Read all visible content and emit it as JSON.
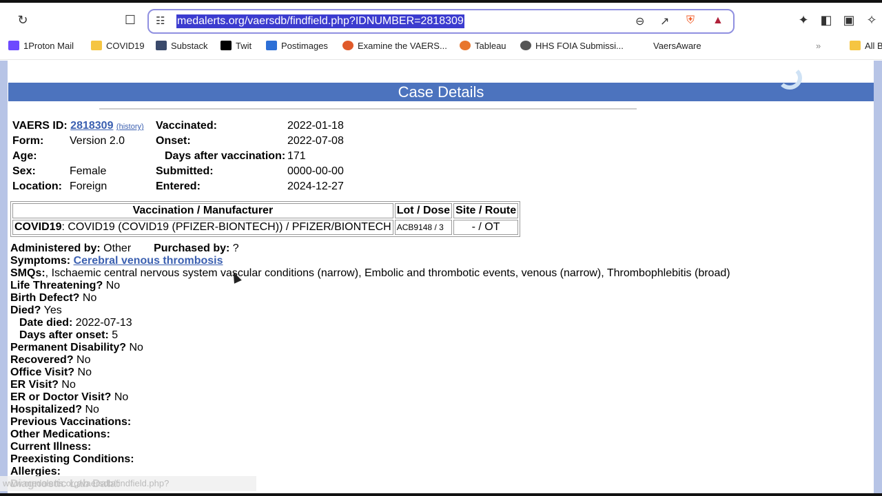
{
  "browser": {
    "url": "medalerts.org/vaersdb/findfield.php?IDNUMBER=2818309",
    "toolbar_icons": [
      "reload-icon",
      "bookmark-icon",
      "site-settings-icon",
      "zoom-out-icon",
      "share-icon",
      "brave-shields-icon",
      "brave-rewards-icon",
      "extensions-icon",
      "sidebar-icon",
      "wallet-icon",
      "leo-ai-icon"
    ],
    "bookmarks": [
      {
        "label": "1Proton Mail",
        "icon": "proton-mail-icon",
        "color": "#6d4aff"
      },
      {
        "label": "COVID19",
        "icon": "folder-icon",
        "color": "#f5c542"
      },
      {
        "label": "Substack",
        "icon": "substack-icon",
        "color": "#3a4a6b"
      },
      {
        "label": "Twit",
        "icon": "x-icon",
        "color": "#000000"
      },
      {
        "label": "Postimages",
        "icon": "postimages-icon",
        "color": "#2d6fd6"
      },
      {
        "label": "Examine the VAERS...",
        "icon": "vaers-icon",
        "color": "#e05a2a"
      },
      {
        "label": "Tableau",
        "icon": "tableau-icon",
        "color": "#e8762d"
      },
      {
        "label": "HHS FOIA Submissi...",
        "icon": "globe-icon",
        "color": "#555555"
      },
      {
        "label": "VaersAware",
        "icon": "",
        "color": ""
      },
      {
        "label": "»",
        "icon": "overflow-icon",
        "color": ""
      },
      {
        "label": "All B",
        "icon": "folder-icon",
        "color": "#f5c542"
      }
    ],
    "status_url": "www.medalerts.org/vaersdb/findfield.php?IDNUMBER=2818309#"
  },
  "page": {
    "banner_title": "Case Details",
    "brand_color": "#4c73be",
    "summary_left": [
      {
        "label": "VAERS ID:",
        "value": "2818309",
        "extra": "(history)"
      },
      {
        "label": "Form:",
        "value": "Version 2.0"
      },
      {
        "label": "Age:",
        "value": ""
      },
      {
        "label": "Sex:",
        "value": "Female"
      },
      {
        "label": "Location:",
        "value": "Foreign"
      }
    ],
    "summary_right": [
      {
        "label": "Vaccinated:",
        "value": "2022-01-18"
      },
      {
        "label": "Onset:",
        "value": "2022-07-08"
      },
      {
        "label": "Days after vaccination:",
        "value": "171"
      },
      {
        "label": "Submitted:",
        "value": "0000-00-00"
      },
      {
        "label": "Entered:",
        "value": "2024-12-27"
      }
    ],
    "vax_table": {
      "headers": [
        "Vaccination / Manufacturer",
        "Lot / Dose",
        "Site / Route"
      ],
      "rows": [
        {
          "type": "COVID19",
          "name": ": COVID19 (COVID19 (PFIZER-BIONTECH)) / PFIZER/BIONTECH",
          "lot": "ACB9148 / 3",
          "site": "- / OT"
        }
      ]
    },
    "administered_label": "Administered by:",
    "administered_value": "Other",
    "purchased_label": "Purchased by:",
    "purchased_value": "?",
    "symptoms_label": "Symptoms:",
    "symptoms_value": "Cerebral venous thrombosis",
    "smqs_label": "SMQs:",
    "smqs_value": ", Ischaemic central nervous system vascular conditions (narrow), Embolic and thrombotic events, venous (narrow), Thrombophlebitis (broad)",
    "fields": [
      {
        "label": "Life Threatening?",
        "value": "No",
        "indent": false
      },
      {
        "label": "Birth Defect?",
        "value": "No",
        "indent": false
      },
      {
        "label": "Died?",
        "value": "Yes",
        "indent": false
      },
      {
        "label": "Date died:",
        "value": "2022-07-13",
        "indent": true
      },
      {
        "label": "Days after onset:",
        "value": "5",
        "indent": true
      },
      {
        "label": "Permanent Disability?",
        "value": "No",
        "indent": false
      },
      {
        "label": "Recovered?",
        "value": "No",
        "indent": false
      },
      {
        "label": "Office Visit?",
        "value": "No",
        "indent": false
      },
      {
        "label": "ER Visit?",
        "value": "No",
        "indent": false
      },
      {
        "label": "ER or Doctor Visit?",
        "value": "No",
        "indent": false
      },
      {
        "label": "Hospitalized?",
        "value": "No",
        "indent": false
      },
      {
        "label": "Previous Vaccinations:",
        "value": "",
        "indent": false
      },
      {
        "label": "Other Medications:",
        "value": "",
        "indent": false
      },
      {
        "label": "Current Illness:",
        "value": "",
        "indent": false
      },
      {
        "label": "Preexisting Conditions:",
        "value": "",
        "indent": false
      },
      {
        "label": "Allergies:",
        "value": "",
        "indent": false
      },
      {
        "label": "Diagnostic Lab Data:",
        "value": "",
        "indent": false
      }
    ]
  }
}
